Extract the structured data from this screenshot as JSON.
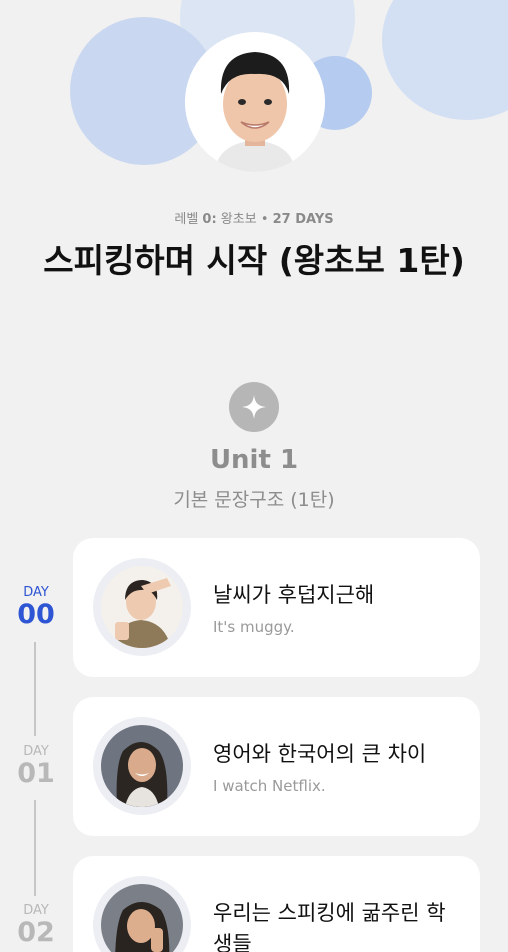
{
  "course": {
    "level_prefix": "레벨 ",
    "level_number": "0:",
    "level_name": " 왕초보 • ",
    "days": "27 DAYS",
    "title": "스피킹하며 시작 (왕초보 1탄)"
  },
  "unit": {
    "title": "Unit 1",
    "subtitle": "기본 문장구조 (1탄)",
    "icon": "sparkle-icon"
  },
  "colors": {
    "accent": "#2e55d3",
    "inactive": "#b8b8b8"
  },
  "lessons": [
    {
      "day_word": "DAY",
      "day_number": "00",
      "title": "날씨가 후덥지근해",
      "subtitle": "It's muggy.",
      "active": true
    },
    {
      "day_word": "DAY",
      "day_number": "01",
      "title": "영어와 한국어의 큰 차이",
      "subtitle": "I watch Netflix.",
      "active": false
    },
    {
      "day_word": "DAY",
      "day_number": "02",
      "title": "우리는 스피킹에 굶주린 학생들",
      "subtitle": "",
      "active": false
    }
  ]
}
